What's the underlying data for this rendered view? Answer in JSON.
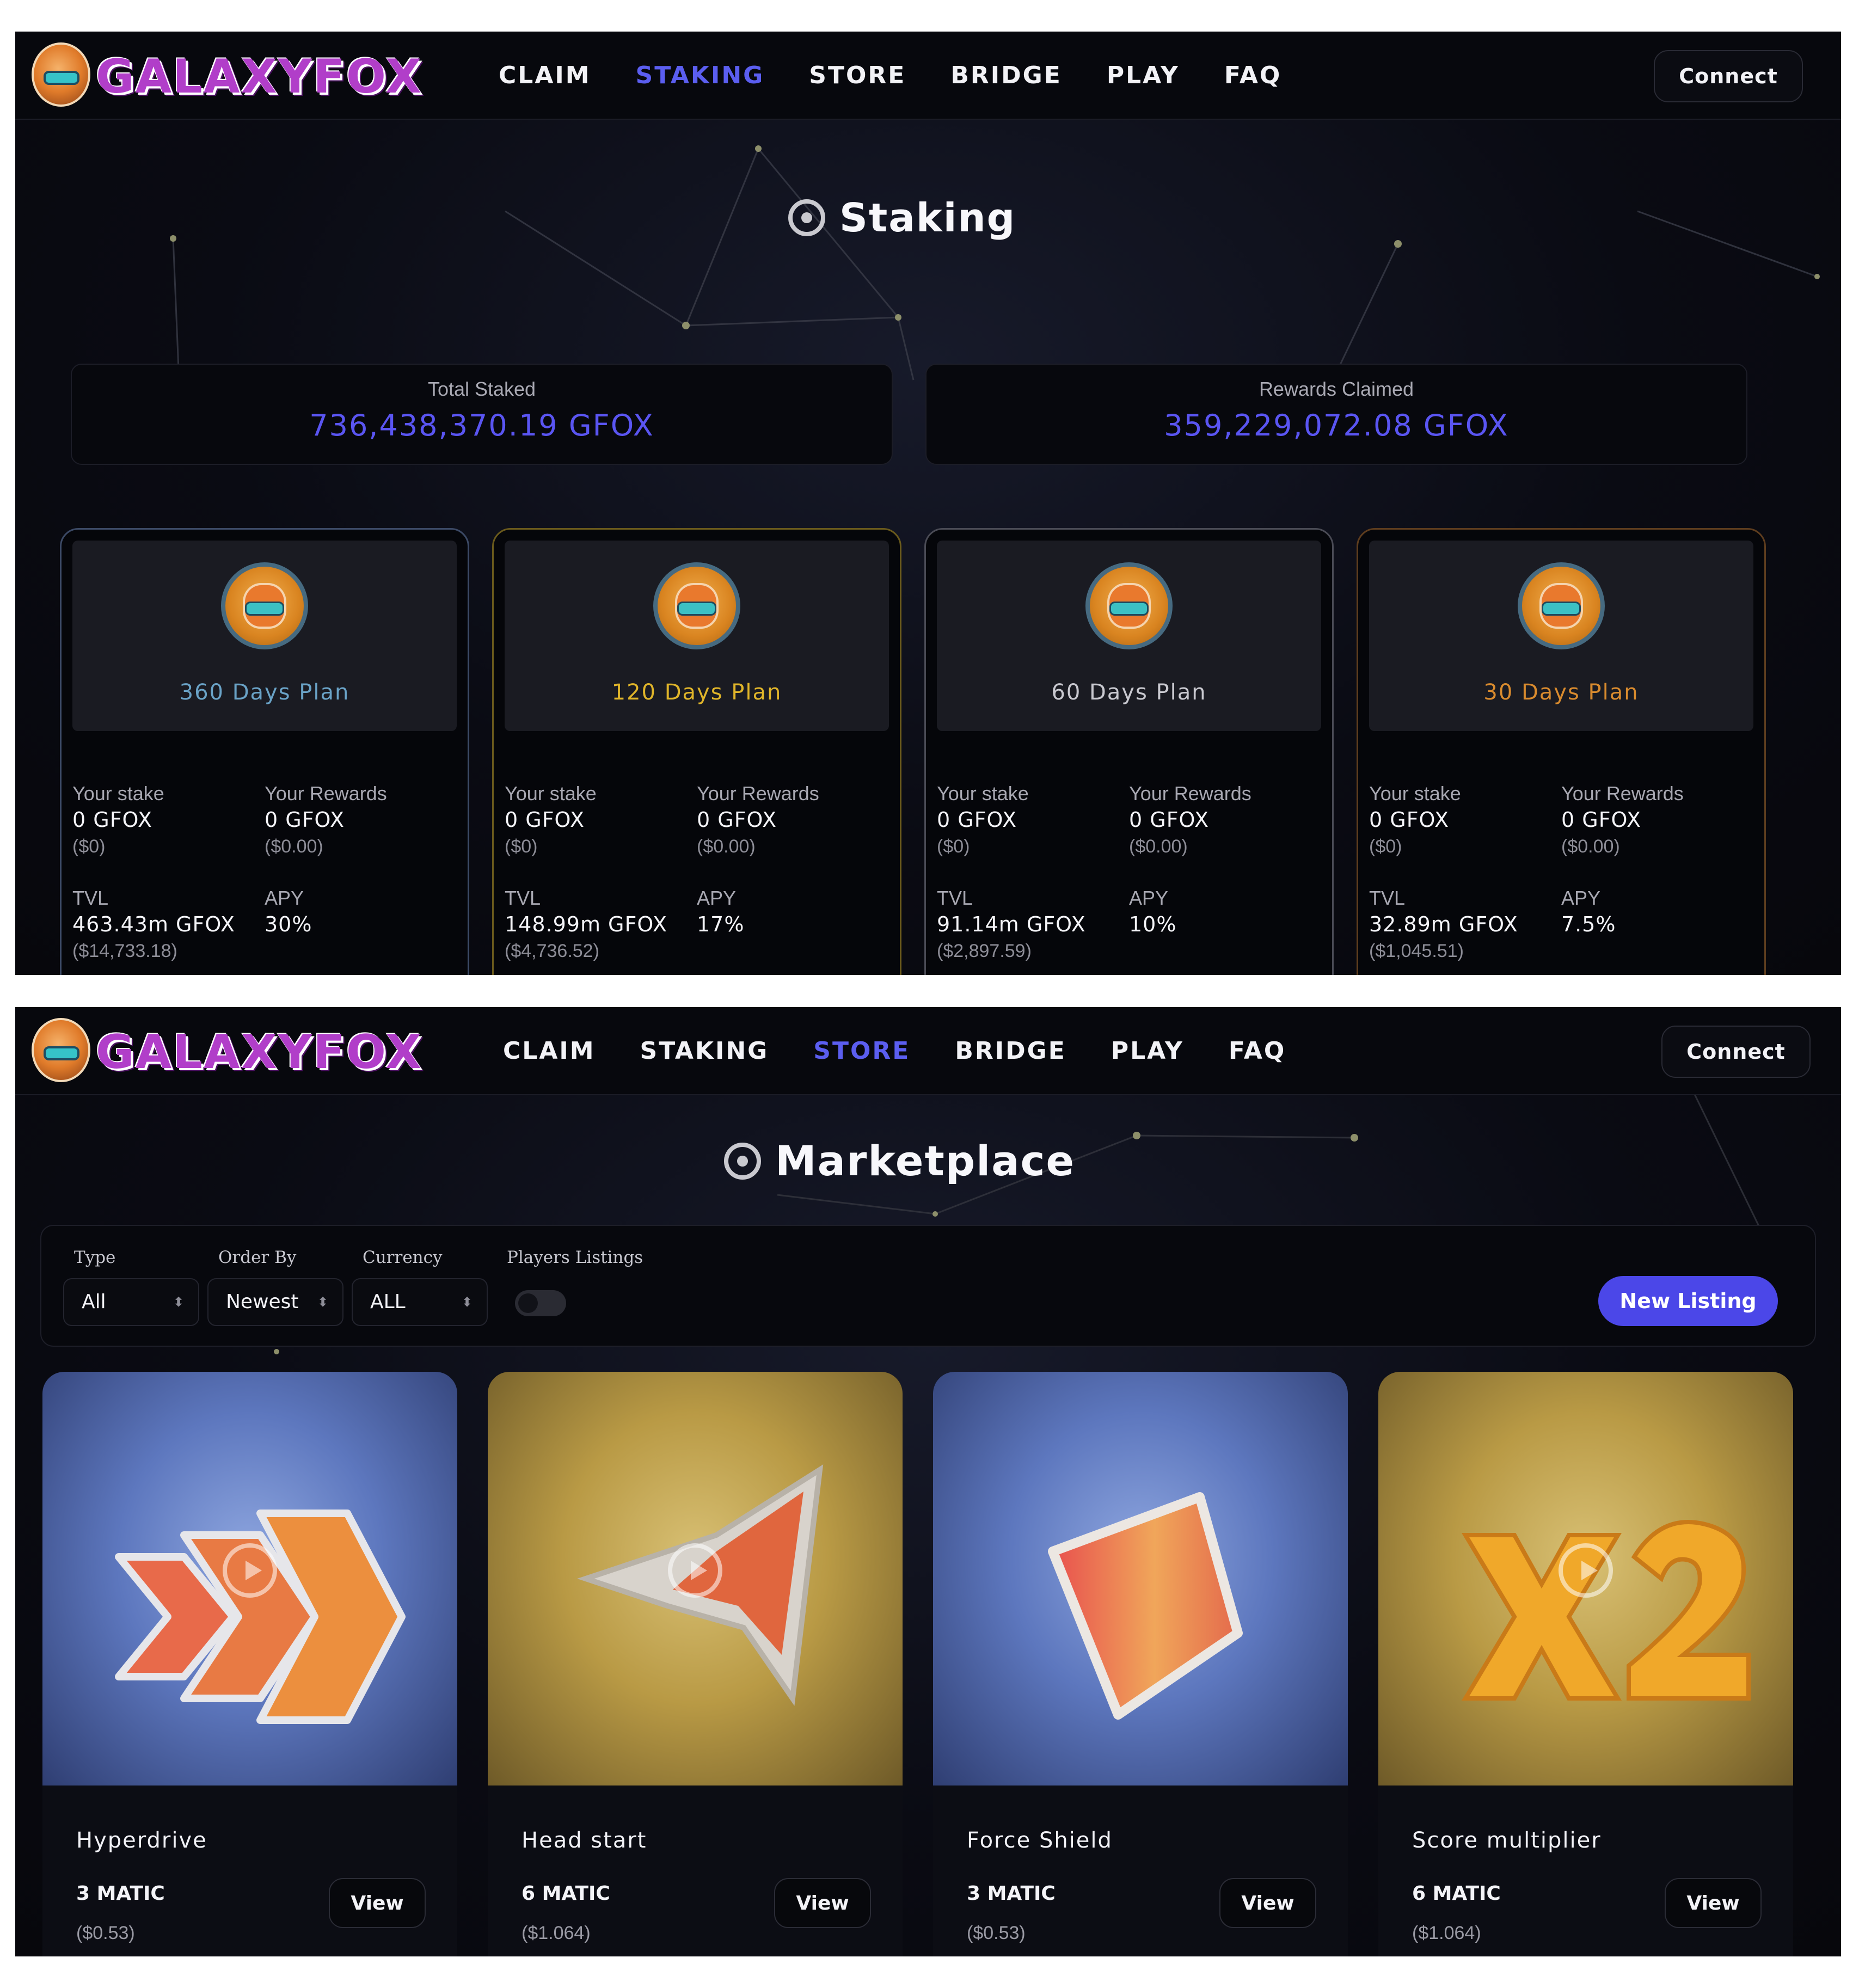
{
  "brand": {
    "name": "GALAXYFOX",
    "accent": "#5b5ef0",
    "logo_color": "#b13ec9"
  },
  "staking_view": {
    "nav": {
      "items": [
        "CLAIM",
        "STAKING",
        "STORE",
        "BRIDGE",
        "PLAY",
        "FAQ"
      ],
      "active": "STAKING",
      "connect_label": "Connect"
    },
    "heading": "Staking",
    "stats": [
      {
        "label": "Total Staked",
        "value": "736,438,370.19 GFOX"
      },
      {
        "label": "Rewards Claimed",
        "value": "359,229,072.08 GFOX"
      }
    ],
    "plans": [
      {
        "title": "360 Days Plan",
        "color": "#6aa3c7",
        "border": "#3c4a66",
        "stake_label": "Your stake",
        "stake_value": "0 GFOX",
        "stake_usd": "($0)",
        "rewards_label": "Your Rewards",
        "rewards_value": "0 GFOX",
        "rewards_usd": "($0.00)",
        "tvl_label": "TVL",
        "tvl_value": "463.43m GFOX",
        "tvl_usd": "($14,733.18)",
        "apy_label": "APY",
        "apy_value": "30%"
      },
      {
        "title": "120 Days Plan",
        "color": "#e0b52a",
        "border": "#6a5a1c",
        "stake_label": "Your stake",
        "stake_value": "0 GFOX",
        "stake_usd": "($0)",
        "rewards_label": "Your Rewards",
        "rewards_value": "0 GFOX",
        "rewards_usd": "($0.00)",
        "tvl_label": "TVL",
        "tvl_value": "148.99m GFOX",
        "tvl_usd": "($4,736.52)",
        "apy_label": "APY",
        "apy_value": "17%"
      },
      {
        "title": "60 Days Plan",
        "color": "#c9c9d0",
        "border": "#4a4b55",
        "stake_label": "Your stake",
        "stake_value": "0 GFOX",
        "stake_usd": "($0)",
        "rewards_label": "Your Rewards",
        "rewards_value": "0 GFOX",
        "rewards_usd": "($0.00)",
        "tvl_label": "TVL",
        "tvl_value": "91.14m GFOX",
        "tvl_usd": "($2,897.59)",
        "apy_label": "APY",
        "apy_value": "10%"
      },
      {
        "title": "30 Days Plan",
        "color": "#d98b2e",
        "border": "#5e3d1e",
        "stake_label": "Your stake",
        "stake_value": "0 GFOX",
        "stake_usd": "($0)",
        "rewards_label": "Your Rewards",
        "rewards_value": "0 GFOX",
        "rewards_usd": "($0.00)",
        "tvl_label": "TVL",
        "tvl_value": "32.89m GFOX",
        "tvl_usd": "($1,045.51)",
        "apy_label": "APY",
        "apy_value": "7.5%"
      }
    ]
  },
  "store_view": {
    "nav": {
      "items": [
        "CLAIM",
        "STAKING",
        "STORE",
        "BRIDGE",
        "PLAY",
        "FAQ"
      ],
      "active": "STORE",
      "connect_label": "Connect"
    },
    "heading": "Marketplace",
    "filters": {
      "type_label": "Type",
      "type_value": "All",
      "order_label": "Order By",
      "order_value": "Newest",
      "currency_label": "Currency",
      "currency_value": "ALL",
      "players_label": "Players Listings",
      "players_toggle_on": false
    },
    "new_listing_label": "New Listing",
    "items": [
      {
        "name": "Hyperdrive",
        "price": "3 MATIC",
        "usd": "($0.53)",
        "view_label": "View",
        "theme": "blue",
        "icon": "chevron-arrows-icon"
      },
      {
        "name": "Head start",
        "price": "6 MATIC",
        "usd": "($1.064)",
        "view_label": "View",
        "theme": "gold",
        "icon": "rocket-arrow-icon"
      },
      {
        "name": "Force Shield",
        "price": "3 MATIC",
        "usd": "($0.53)",
        "view_label": "View",
        "theme": "blue",
        "icon": "shield-icon"
      },
      {
        "name": "Score multiplier",
        "price": "6 MATIC",
        "usd": "($1.064)",
        "view_label": "View",
        "theme": "gold",
        "icon": "x2-multiplier-icon"
      }
    ]
  }
}
